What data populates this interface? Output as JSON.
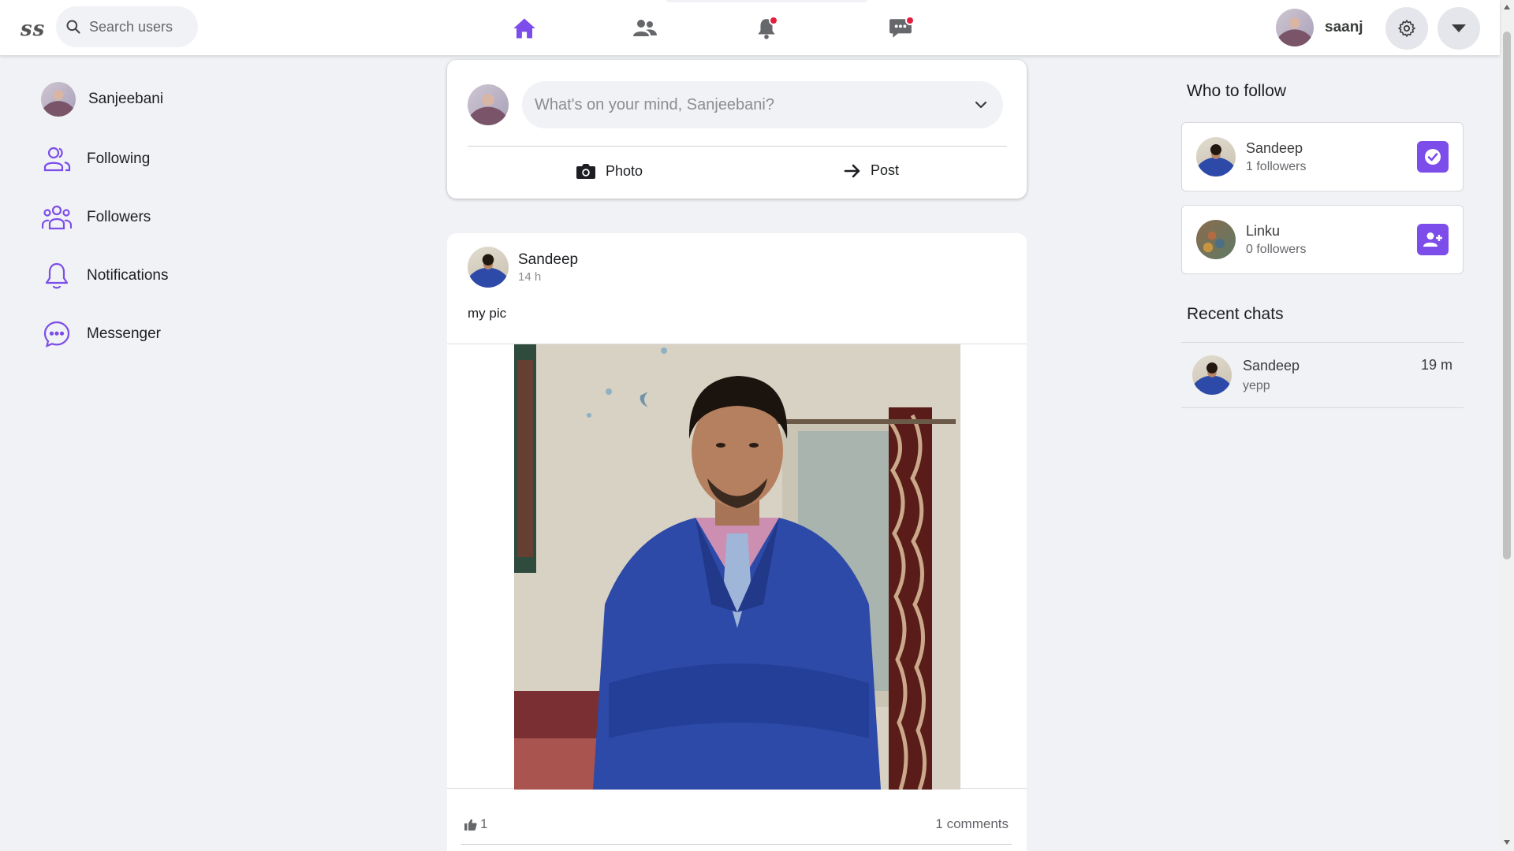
{
  "app": {
    "logo": "ss",
    "search": {
      "placeholder": "Search users"
    },
    "nav": [
      {
        "name": "home",
        "icon": "home-icon",
        "active": true
      },
      {
        "name": "friends",
        "icon": "users-icon",
        "badge": false
      },
      {
        "name": "notifications",
        "icon": "bell-icon",
        "badge": true
      },
      {
        "name": "messages",
        "icon": "chat-icon",
        "badge": true
      }
    ],
    "user": {
      "username": "saanj"
    },
    "colors": {
      "accent": "#7c4dea",
      "badge": "#e41e3f",
      "background": "#f0f2f5"
    }
  },
  "left_nav": {
    "profile_name": "Sanjeebani",
    "items": [
      {
        "label": "Following",
        "icon": "following-icon"
      },
      {
        "label": "Followers",
        "icon": "followers-icon"
      },
      {
        "label": "Notifications",
        "icon": "bell-outline-icon"
      },
      {
        "label": "Messenger",
        "icon": "messenger-icon"
      }
    ]
  },
  "composer": {
    "placeholder": "What's on your mind, Sanjeebani?",
    "photo_label": "Photo",
    "post_label": "Post"
  },
  "post": {
    "author": "Sandeep",
    "time": "14 h",
    "text": "my pic",
    "likes": "1",
    "comments": "1 comments"
  },
  "right": {
    "who_to_follow_title": "Who to follow",
    "suggestions": [
      {
        "name": "Sandeep",
        "followers": "1 followers",
        "status": "following"
      },
      {
        "name": "Linku",
        "followers": "0 followers",
        "status": "not-following"
      }
    ],
    "recent_chats_title": "Recent chats",
    "chats": [
      {
        "name": "Sandeep",
        "message": "yepp",
        "time": "19 m"
      }
    ]
  }
}
